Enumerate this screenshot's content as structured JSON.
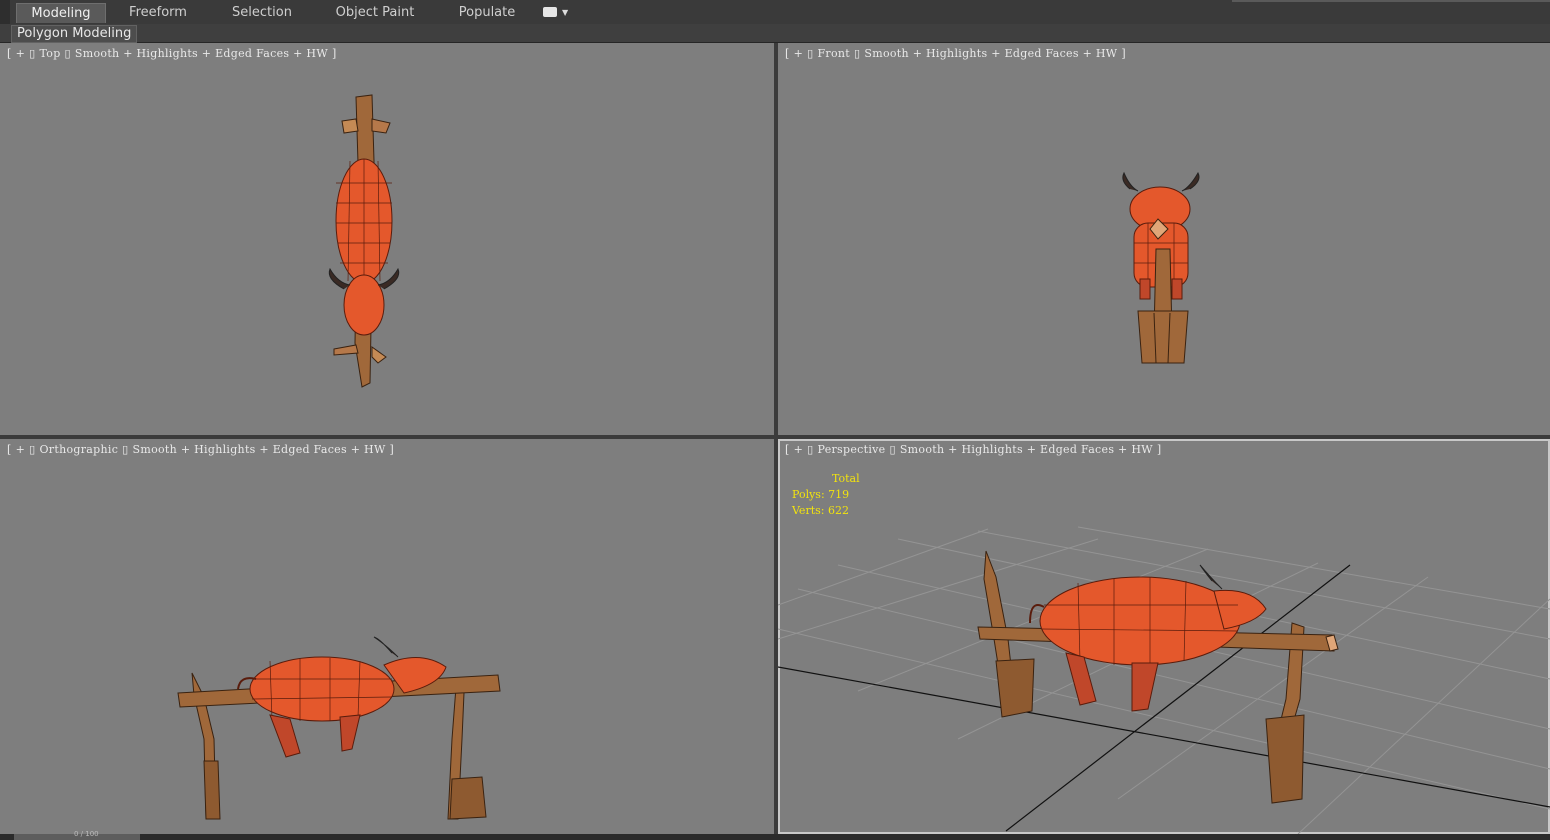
{
  "ribbon": {
    "tabs": [
      {
        "label": "Modeling",
        "active": true
      },
      {
        "label": "Freeform",
        "active": false
      },
      {
        "label": "Selection",
        "active": false
      },
      {
        "label": "Object Paint",
        "active": false
      },
      {
        "label": "Populate",
        "active": false
      }
    ],
    "menu_icon": "ribbon-options-icon",
    "panel_label": "Polygon Modeling"
  },
  "viewports": [
    {
      "id": "top",
      "bracket_open": "[",
      "plus": "+",
      "view": "Top",
      "shading": "Smooth + Highlights + Edged Faces + HW",
      "bracket_close": "]"
    },
    {
      "id": "front",
      "bracket_open": "[",
      "plus": "+",
      "view": "Front",
      "shading": "Smooth + Highlights + Edged Faces + HW",
      "bracket_close": "]"
    },
    {
      "id": "orthographic",
      "bracket_open": "[",
      "plus": "+",
      "view": "Orthographic",
      "shading": "Smooth + Highlights + Edged Faces + HW",
      "bracket_close": "]"
    },
    {
      "id": "perspective",
      "bracket_open": "[",
      "plus": "+",
      "view": "Perspective",
      "shading": "Smooth + Highlights + Edged Faces + HW",
      "bracket_close": "]"
    }
  ],
  "stats": {
    "title": "Total",
    "polys_label": "Polys:",
    "polys": "719",
    "verts_label": "Verts:",
    "verts": "622"
  },
  "colors": {
    "viewport_bg": "#7e7e7e",
    "stats_text": "#f2e30e",
    "mesh": "#e4582c",
    "wood": "#a0683a"
  },
  "timeline": {
    "frame": "0 / 100"
  }
}
